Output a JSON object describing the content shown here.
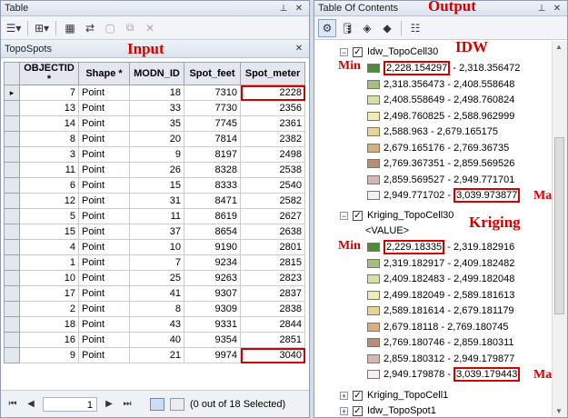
{
  "table_window": {
    "title": "Table",
    "sub_title": "TopoSpots",
    "annotation": "Input",
    "columns": [
      "OBJECTID *",
      "Shape *",
      "MODN_ID",
      "Spot_feet",
      "Spot_meter"
    ],
    "rows": [
      [
        "7",
        "Point",
        "18",
        "7310",
        "2228"
      ],
      [
        "13",
        "Point",
        "33",
        "7730",
        "2356"
      ],
      [
        "14",
        "Point",
        "35",
        "7745",
        "2361"
      ],
      [
        "8",
        "Point",
        "20",
        "7814",
        "2382"
      ],
      [
        "3",
        "Point",
        "9",
        "8197",
        "2498"
      ],
      [
        "11",
        "Point",
        "26",
        "8328",
        "2538"
      ],
      [
        "6",
        "Point",
        "15",
        "8333",
        "2540"
      ],
      [
        "12",
        "Point",
        "31",
        "8471",
        "2582"
      ],
      [
        "5",
        "Point",
        "11",
        "8619",
        "2627"
      ],
      [
        "15",
        "Point",
        "37",
        "8654",
        "2638"
      ],
      [
        "4",
        "Point",
        "10",
        "9190",
        "2801"
      ],
      [
        "1",
        "Point",
        "7",
        "9234",
        "2815"
      ],
      [
        "10",
        "Point",
        "25",
        "9263",
        "2823"
      ],
      [
        "17",
        "Point",
        "41",
        "9307",
        "2837"
      ],
      [
        "2",
        "Point",
        "8",
        "9309",
        "2838"
      ],
      [
        "18",
        "Point",
        "43",
        "9331",
        "2844"
      ],
      [
        "16",
        "Point",
        "40",
        "9354",
        "2851"
      ],
      [
        "9",
        "Point",
        "21",
        "9974",
        "3040"
      ]
    ],
    "page_value": "1",
    "selection_status": "(0 out of 18 Selected)"
  },
  "toc": {
    "title": "Table Of Contents",
    "annotation_output": "Output",
    "annotation_idw": "IDW",
    "annotation_kriging": "Kriging",
    "min_label": "Min",
    "max_label": "Max",
    "layers": [
      {
        "name": "Idw_TopoCell30",
        "classes": [
          {
            "color": "#4e8b3a",
            "low": "2,228.154297",
            "high": "2,318.356472"
          },
          {
            "color": "#a2c07c",
            "low": "2,318.356473",
            "high": "2,408.558648"
          },
          {
            "color": "#d6e2a4",
            "low": "2,408.558649",
            "high": "2,498.760824"
          },
          {
            "color": "#f3ecb2",
            "low": "2,498.760825",
            "high": "2,588.962999"
          },
          {
            "color": "#ecd390",
            "low": "2,588.963",
            "high": "2,679.165175"
          },
          {
            "color": "#d7ae7e",
            "low": "2,679.165176",
            "high": "2,769.36735"
          },
          {
            "color": "#b98d73",
            "low": "2,769.367351",
            "high": "2,859.569526"
          },
          {
            "color": "#d5b7b1",
            "low": "2,859.569527",
            "high": "2,949.771701"
          },
          {
            "color": "#f7eef4",
            "low": "2,949.771702",
            "high": "3,039.973877"
          }
        ]
      },
      {
        "name": "Kriging_TopoCell30",
        "value_label": "<VALUE>",
        "classes": [
          {
            "color": "#4e8b3a",
            "low": "2,229.18335",
            "high": "2,319.182916"
          },
          {
            "color": "#a2c07c",
            "low": "2,319.182917",
            "high": "2,409.182482"
          },
          {
            "color": "#d6e2a4",
            "low": "2,409.182483",
            "high": "2,499.182048"
          },
          {
            "color": "#f3ecb2",
            "low": "2,499.182049",
            "high": "2,589.181613"
          },
          {
            "color": "#ecd390",
            "low": "2,589.181614",
            "high": "2,679.181179"
          },
          {
            "color": "#d7ae7e",
            "low": "2,679.18118",
            "high": "2,769.180745"
          },
          {
            "color": "#b98d73",
            "low": "2,769.180746",
            "high": "2,859.180311"
          },
          {
            "color": "#d5b7b1",
            "low": "2,859.180312",
            "high": "2,949.179877"
          },
          {
            "color": "#f7eef4",
            "low": "2,949.179878",
            "high": "3,039.179443"
          }
        ]
      },
      {
        "name": "Kriging_TopoCell1"
      },
      {
        "name": "Idw_TopoSpot1"
      }
    ]
  }
}
